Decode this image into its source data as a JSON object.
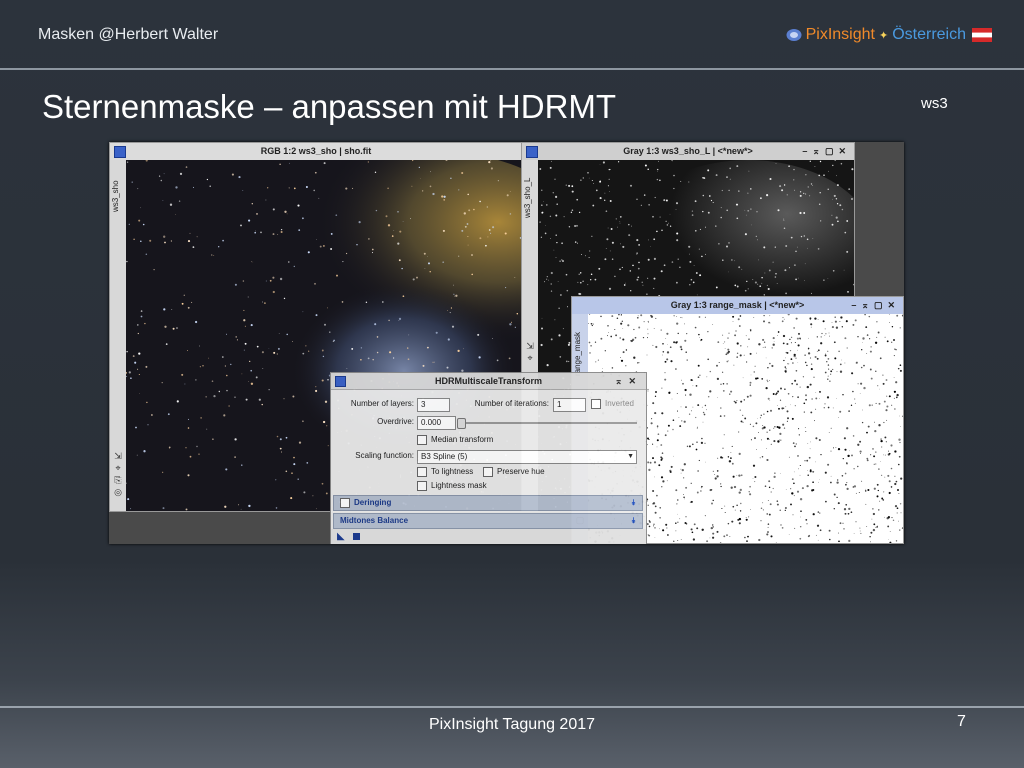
{
  "header": {
    "left": "Masken  @Herbert Walter",
    "brand": "PixInsight",
    "region": "Österreich"
  },
  "slide": {
    "title": "Sternenmaske – anpassen mit HDRMT",
    "tag": "ws3",
    "footer": "PixInsight Tagung 2017",
    "page": "7"
  },
  "windows": {
    "rgb": {
      "title": "RGB 1:2 ws3_sho | sho.fit",
      "side_label": "ws3_sho"
    },
    "gray1": {
      "title": "Gray 1:3 ws3_sho_L | <*new*>",
      "side_label": "ws3_sho_L"
    },
    "gray2": {
      "title": "Gray 1:3 range_mask | <*new*>",
      "side_label": "range_mask"
    }
  },
  "dialog": {
    "title": "HDRMultiscaleTransform",
    "layers_label": "Number of layers:",
    "layers_value": "3",
    "iterations_label": "Number of iterations:",
    "iterations_value": "1",
    "inverted_label": "Inverted",
    "overdrive_label": "Overdrive:",
    "overdrive_value": "0.000",
    "median_label": "Median transform",
    "scaling_label": "Scaling function:",
    "scaling_value": "B3 Spline (5)",
    "to_lightness_label": "To lightness",
    "preserve_hue_label": "Preserve hue",
    "lightness_mask_label": "Lightness mask",
    "deringing_label": "Deringing",
    "midtones_label": "Midtones Balance"
  },
  "colors": {
    "brand": "#f08a2a",
    "region": "#4a9ae0",
    "section": "#b5bfd0"
  }
}
